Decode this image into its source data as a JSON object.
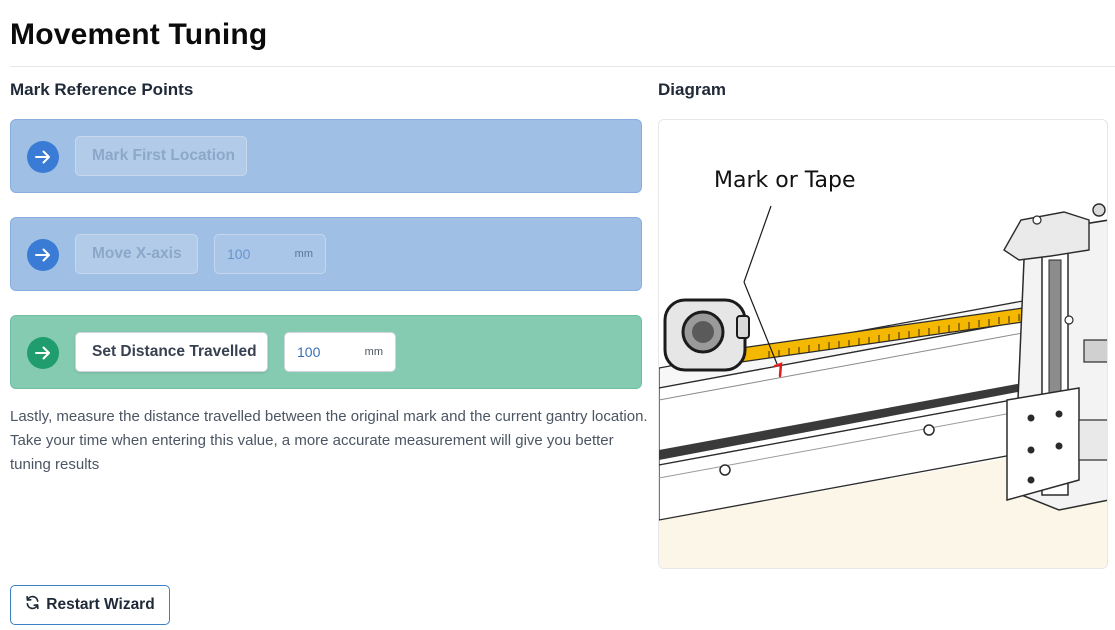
{
  "page": {
    "title": "Movement Tuning"
  },
  "left_panel": {
    "title": "Mark Reference Points"
  },
  "steps": [
    {
      "state": "disabled",
      "button_label": "Mark First Location",
      "icon": "arrow-right-icon"
    },
    {
      "state": "disabled",
      "button_label": "Move X-axis",
      "input_value": "100",
      "unit": "mm",
      "icon": "arrow-right-icon"
    },
    {
      "state": "active",
      "button_label": "Set Distance Travelled",
      "input_value": "100",
      "unit": "mm",
      "icon": "arrow-right-icon"
    }
  ],
  "instructions": "Lastly, measure the distance travelled between the original mark and the current gantry location. Take your time when entering this value, a more accurate measurement will give you better tuning results",
  "diagram": {
    "title": "Diagram",
    "callout": "Mark or Tape"
  },
  "footer": {
    "restart_label": "Restart Wizard",
    "restart_icon": "refresh-icon"
  },
  "colors": {
    "step_disabled_bg": "#9fc0e4",
    "step_active_bg": "#85cbb2",
    "icon_blue": "#3a7bd5",
    "icon_green": "#1f9d6e",
    "tape_yellow": "#f5b800",
    "mark_red": "#e21b1b"
  }
}
